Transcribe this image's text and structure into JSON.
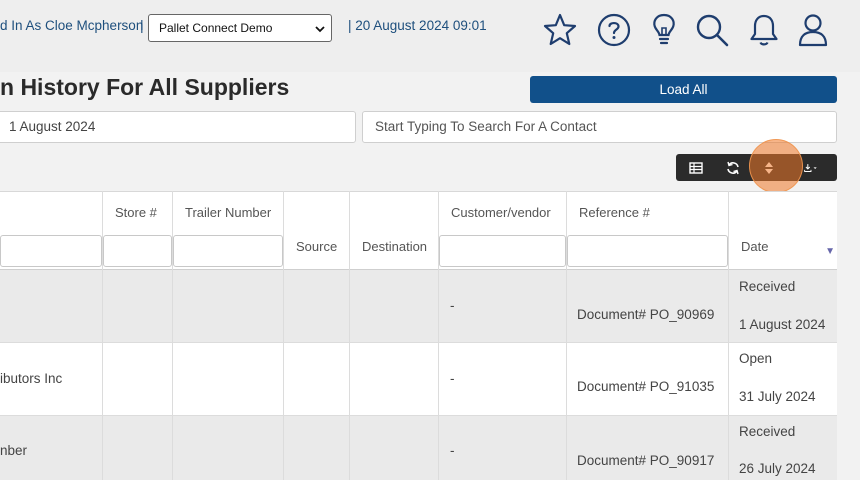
{
  "header": {
    "login_text": "d In As Cloe Mcpherson",
    "separator": "|",
    "company_select": "Pallet Connect Demo",
    "datetime": "| 20 August 2024 09:01"
  },
  "icons": [
    "star-icon",
    "help-icon",
    "lightbulb-icon",
    "search-icon",
    "bell-icon",
    "user-icon"
  ],
  "page": {
    "title": "n History For All Suppliers",
    "load_all_label": "Load All",
    "date_value": "1 August 2024",
    "contact_placeholder": "Start Typing To Search For A Contact"
  },
  "columns": {
    "store": "Store #",
    "trailer": "Trailer Number",
    "source": "Source",
    "destination": "Destination",
    "customer": "Customer/vendor",
    "reference": "Reference #",
    "date": "Date"
  },
  "rows": [
    {
      "name": "",
      "customer": "-",
      "reference": "Document# PO_90969",
      "status": "Received",
      "date": "1 August 2024"
    },
    {
      "name": "ibutors Inc",
      "customer": "-",
      "reference": "Document# PO_91035",
      "status": "Open",
      "date": "31 July 2024"
    },
    {
      "name": "nber",
      "customer": "-",
      "reference": "Document# PO_90917",
      "status": "Received",
      "date": "26 July 2024"
    }
  ],
  "colors": {
    "accent": "#11508a",
    "link": "#1e4f7d",
    "toolbar": "#2b2b2b",
    "highlight": "#f07828"
  }
}
